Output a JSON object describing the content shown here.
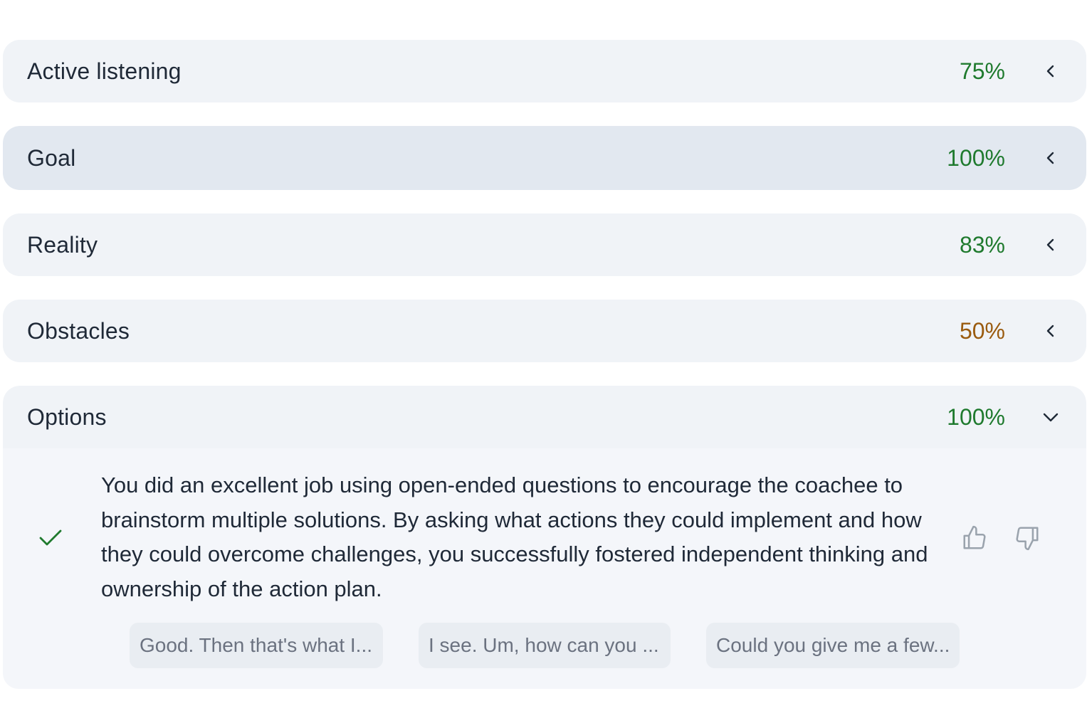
{
  "sections": [
    {
      "title": "Active listening",
      "score": "75%",
      "score_color": "#1f7a2e",
      "state": "collapsed"
    },
    {
      "title": "Goal",
      "score": "100%",
      "score_color": "#1f7a2e",
      "state": "collapsed-hover"
    },
    {
      "title": "Reality",
      "score": "83%",
      "score_color": "#1f7a2e",
      "state": "collapsed"
    },
    {
      "title": "Obstacles",
      "score": "50%",
      "score_color": "#9a5b0f",
      "state": "collapsed"
    },
    {
      "title": "Options",
      "score": "100%",
      "score_color": "#1f7a2e",
      "state": "expanded"
    }
  ],
  "options_panel": {
    "status_icon": "check-icon",
    "feedback": "You did an excellent job using open-ended questions to encourage the coachee to brainstorm multiple solutions. By asking what actions they could implement and how they could overcome challenges, you successfully fostered independent thinking and ownership of the action plan.",
    "rating_icons": [
      "thumbs-up-icon",
      "thumbs-down-icon"
    ],
    "excerpts": [
      "Good. Then that's what I...",
      "I see. Um, how can you ...",
      "Could you give me a few..."
    ]
  },
  "colors": {
    "green": "#1f7a2e",
    "amber": "#9a5b0f",
    "header_bg": "#f0f3f7",
    "header_bg_active": "#e2e8f0",
    "panel_bg": "#f4f6fa"
  }
}
